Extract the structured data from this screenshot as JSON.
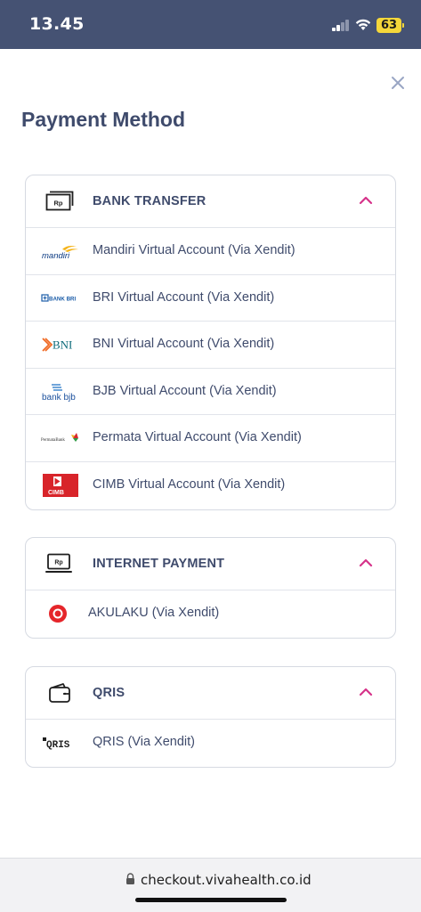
{
  "status_bar": {
    "time": "13.45",
    "battery": "63"
  },
  "modal": {
    "title": "Payment Method",
    "close_icon": "close-icon"
  },
  "sections": [
    {
      "id": "bank-transfer",
      "title": "BANK TRANSFER",
      "icon": "bank-transfer-icon",
      "items": [
        {
          "label": "Mandiri Virtual Account (Via Xendit)",
          "logo": "mandiri-logo",
          "logo_text": "mandiri"
        },
        {
          "label": "BRI Virtual Account (Via Xendit)",
          "logo": "bri-logo",
          "logo_text": "BANK BRI"
        },
        {
          "label": "BNI Virtual Account (Via Xendit)",
          "logo": "bni-logo",
          "logo_text": "BNI"
        },
        {
          "label": "BJB Virtual Account (Via Xendit)",
          "logo": "bjb-logo",
          "logo_text": "bank bjb"
        },
        {
          "label": "Permata Virtual Account (Via Xendit)",
          "logo": "permata-logo",
          "logo_text": "PermataBank"
        },
        {
          "label": "CIMB Virtual Account (Via Xendit)",
          "logo": "cimb-logo",
          "logo_text": "CIMB"
        }
      ]
    },
    {
      "id": "internet-payment",
      "title": "INTERNET PAYMENT",
      "icon": "internet-payment-icon",
      "items": [
        {
          "label": "AKULAKU (Via Xendit)",
          "logo": "akulaku-logo"
        }
      ]
    },
    {
      "id": "qris",
      "title": "QRIS",
      "icon": "wallet-icon",
      "items": [
        {
          "label": "QRIS (Via Xendit)",
          "logo": "qris-logo",
          "logo_text": "QRIS"
        }
      ]
    }
  ],
  "url_bar": {
    "url": "checkout.vivahealth.co.id"
  },
  "colors": {
    "status_bar": "#455273",
    "title": "#3f4b6c",
    "accent": "#d6338a",
    "border": "#d6dae2"
  }
}
